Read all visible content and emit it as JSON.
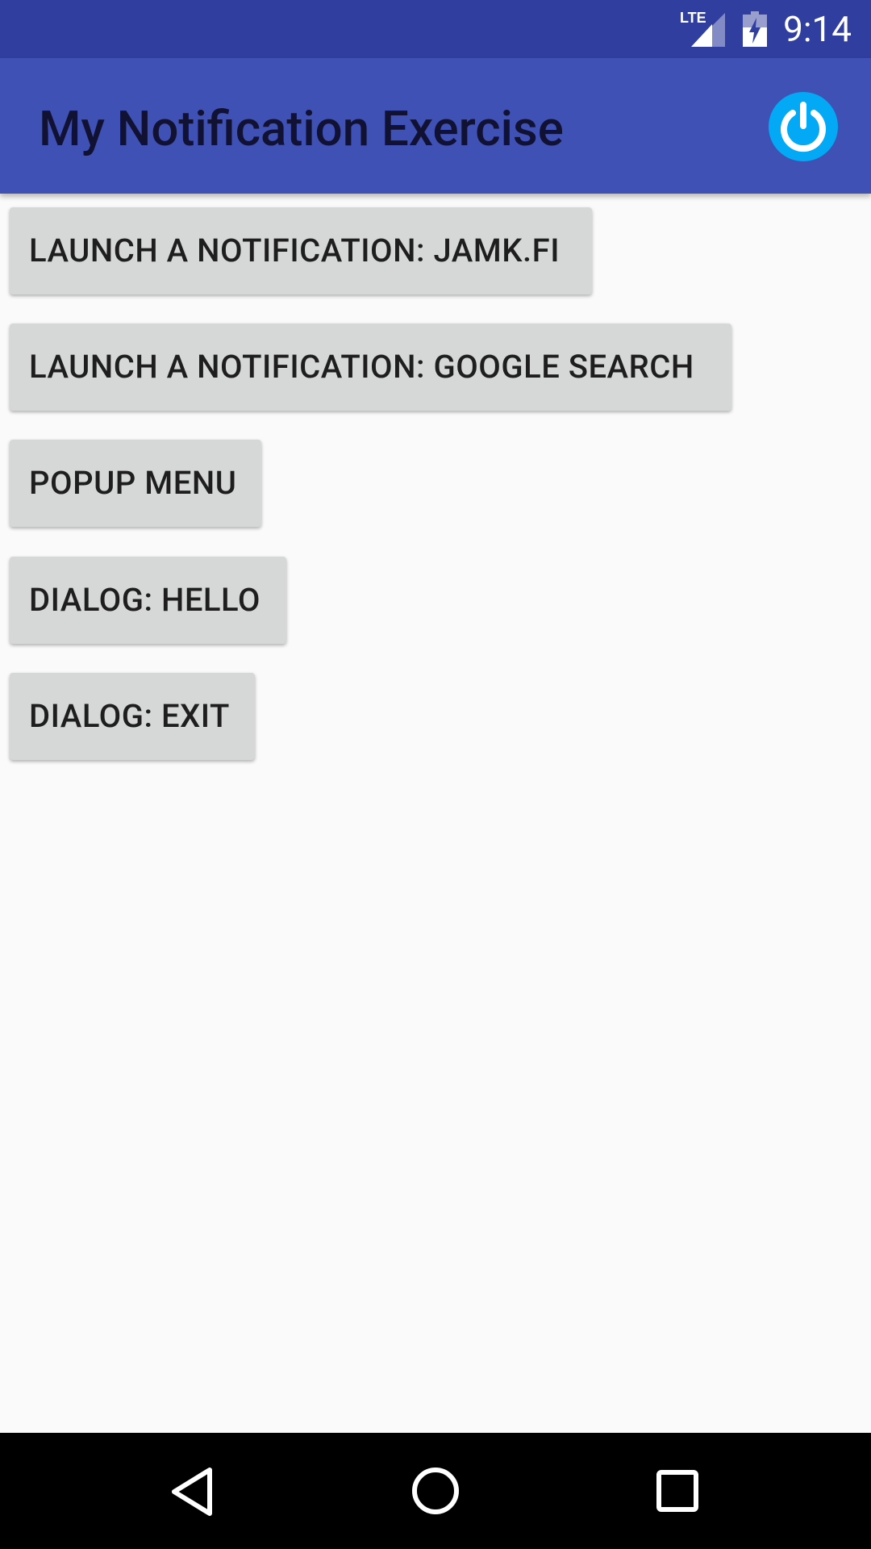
{
  "status_bar": {
    "network_label": "LTE",
    "time": "9:14",
    "background_color": "#303f9f"
  },
  "app_bar": {
    "title": "My Notification Exercise",
    "action_icon": "power-icon",
    "background_color": "#3f51b5",
    "action_color": "#03a9f4"
  },
  "buttons": [
    {
      "label": "LAUNCH A NOTIFICATION: JAMK.FI"
    },
    {
      "label": "LAUNCH A NOTIFICATION: GOOGLE SEARCH"
    },
    {
      "label": "POPUP MENU"
    },
    {
      "label": "DIALOG: HELLO"
    },
    {
      "label": "DIALOG: EXIT"
    }
  ],
  "nav_bar": {
    "icons": [
      "back-icon",
      "home-icon",
      "recents-icon"
    ]
  }
}
